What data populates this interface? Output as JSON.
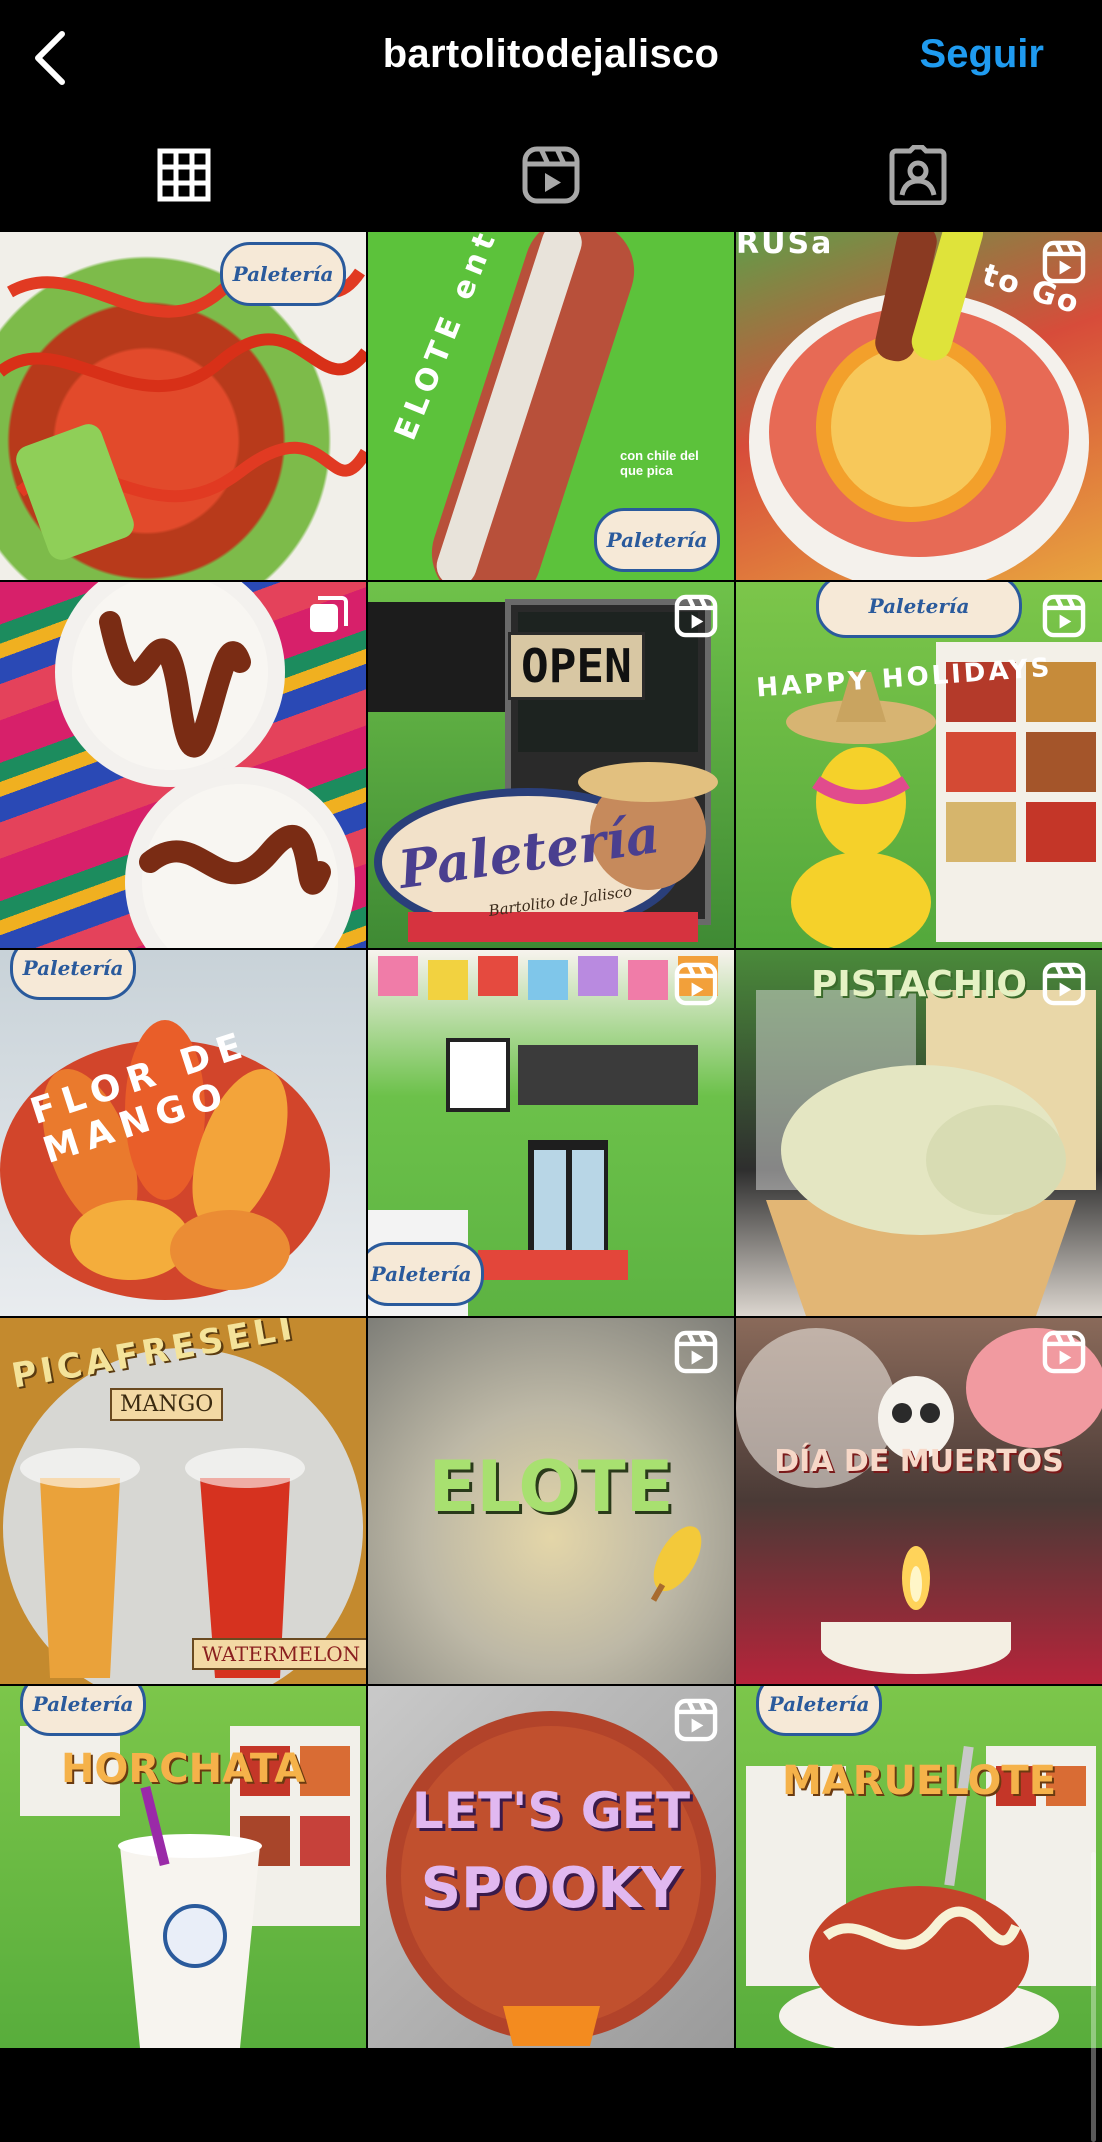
{
  "header": {
    "username": "bartolitodejalisco",
    "follow_label": "Seguir"
  },
  "tabs": [
    {
      "name": "grid-icon",
      "active": true
    },
    {
      "name": "reels-icon",
      "active": false
    },
    {
      "name": "tagged-icon",
      "active": false
    }
  ],
  "posts": {
    "p1": {
      "logo": "Paletería"
    },
    "p2": {
      "text": "ELOTE entero",
      "sub": "con chile del que pica",
      "logo": "Paletería"
    },
    "p3": {
      "text_left": "RUSa",
      "text_right": "to Go"
    },
    "p4": {},
    "p5": {
      "sign": "OPEN",
      "logo": "Paletería",
      "sub": "Bartolito de Jalisco"
    },
    "p6": {
      "text": "HAPPY HOLIDAYS",
      "logo": "Paletería"
    },
    "p7": {
      "text": "FLOR DE MANGO",
      "logo": "Paletería"
    },
    "p8": {
      "logo": "Paletería"
    },
    "p9": {
      "text": "PISTACHIO"
    },
    "p10": {
      "text": "PICAFRESELI",
      "label_a": "MANGO",
      "label_b": "WATERMELON"
    },
    "p11": {
      "text": "ELOTE"
    },
    "p12": {
      "text": "DÍA DE MUERTOS"
    },
    "p13": {
      "text": "HORCHATA",
      "logo": "Paletería"
    },
    "p14": {
      "line1": "LET'S GET",
      "line2": "SPOOKY"
    },
    "p15": {
      "text": "MARUELOTE",
      "logo": "Paletería"
    }
  },
  "colors": {
    "follow": "#1f9bf0",
    "background": "#000000"
  }
}
